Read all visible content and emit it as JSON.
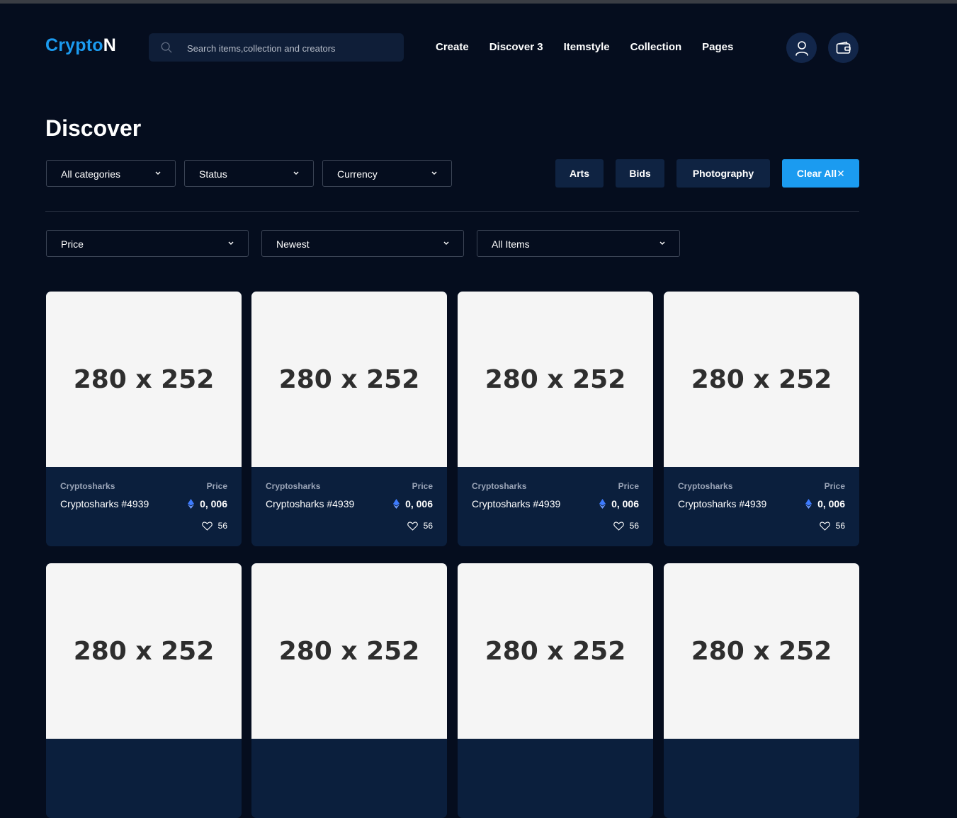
{
  "brand": {
    "part1": "Crypto",
    "part2": "N"
  },
  "search": {
    "placeholder": "Search items,collection and creators"
  },
  "nav": [
    "Create",
    "Discover 3",
    "Itemstyle",
    "Collection",
    "Pages"
  ],
  "page_title": "Discover",
  "filters_row1": [
    "All categories",
    "Status",
    "Currency"
  ],
  "pills": [
    "Arts",
    "Bids",
    "Photography"
  ],
  "clear_all": "Clear All",
  "filters_row2": [
    "Price",
    "Newest",
    "All Items"
  ],
  "cards": [
    {
      "image_label": "280 x 252",
      "collection": "Cryptosharks",
      "price_label": "Price",
      "name": "Cryptosharks #4939",
      "price": "0, 006",
      "likes": "56"
    },
    {
      "image_label": "280 x 252",
      "collection": "Cryptosharks",
      "price_label": "Price",
      "name": "Cryptosharks #4939",
      "price": "0, 006",
      "likes": "56"
    },
    {
      "image_label": "280 x 252",
      "collection": "Cryptosharks",
      "price_label": "Price",
      "name": "Cryptosharks #4939",
      "price": "0, 006",
      "likes": "56"
    },
    {
      "image_label": "280 x 252",
      "collection": "Cryptosharks",
      "price_label": "Price",
      "name": "Cryptosharks #4939",
      "price": "0, 006",
      "likes": "56"
    },
    {
      "image_label": "280 x 252"
    },
    {
      "image_label": "280 x 252"
    },
    {
      "image_label": "280 x 252"
    },
    {
      "image_label": "280 x 252"
    }
  ],
  "icons": {
    "search": "search-icon",
    "user": "user-icon",
    "wallet": "wallet-icon",
    "eth": "ethereum-icon",
    "heart": "heart-icon",
    "chevron": "chevron-down-icon",
    "close": "close-icon"
  },
  "colors": {
    "background": "#050d1e",
    "accent": "#1b9bf0",
    "card": "#0b1f3d",
    "pill": "#0f2342"
  }
}
